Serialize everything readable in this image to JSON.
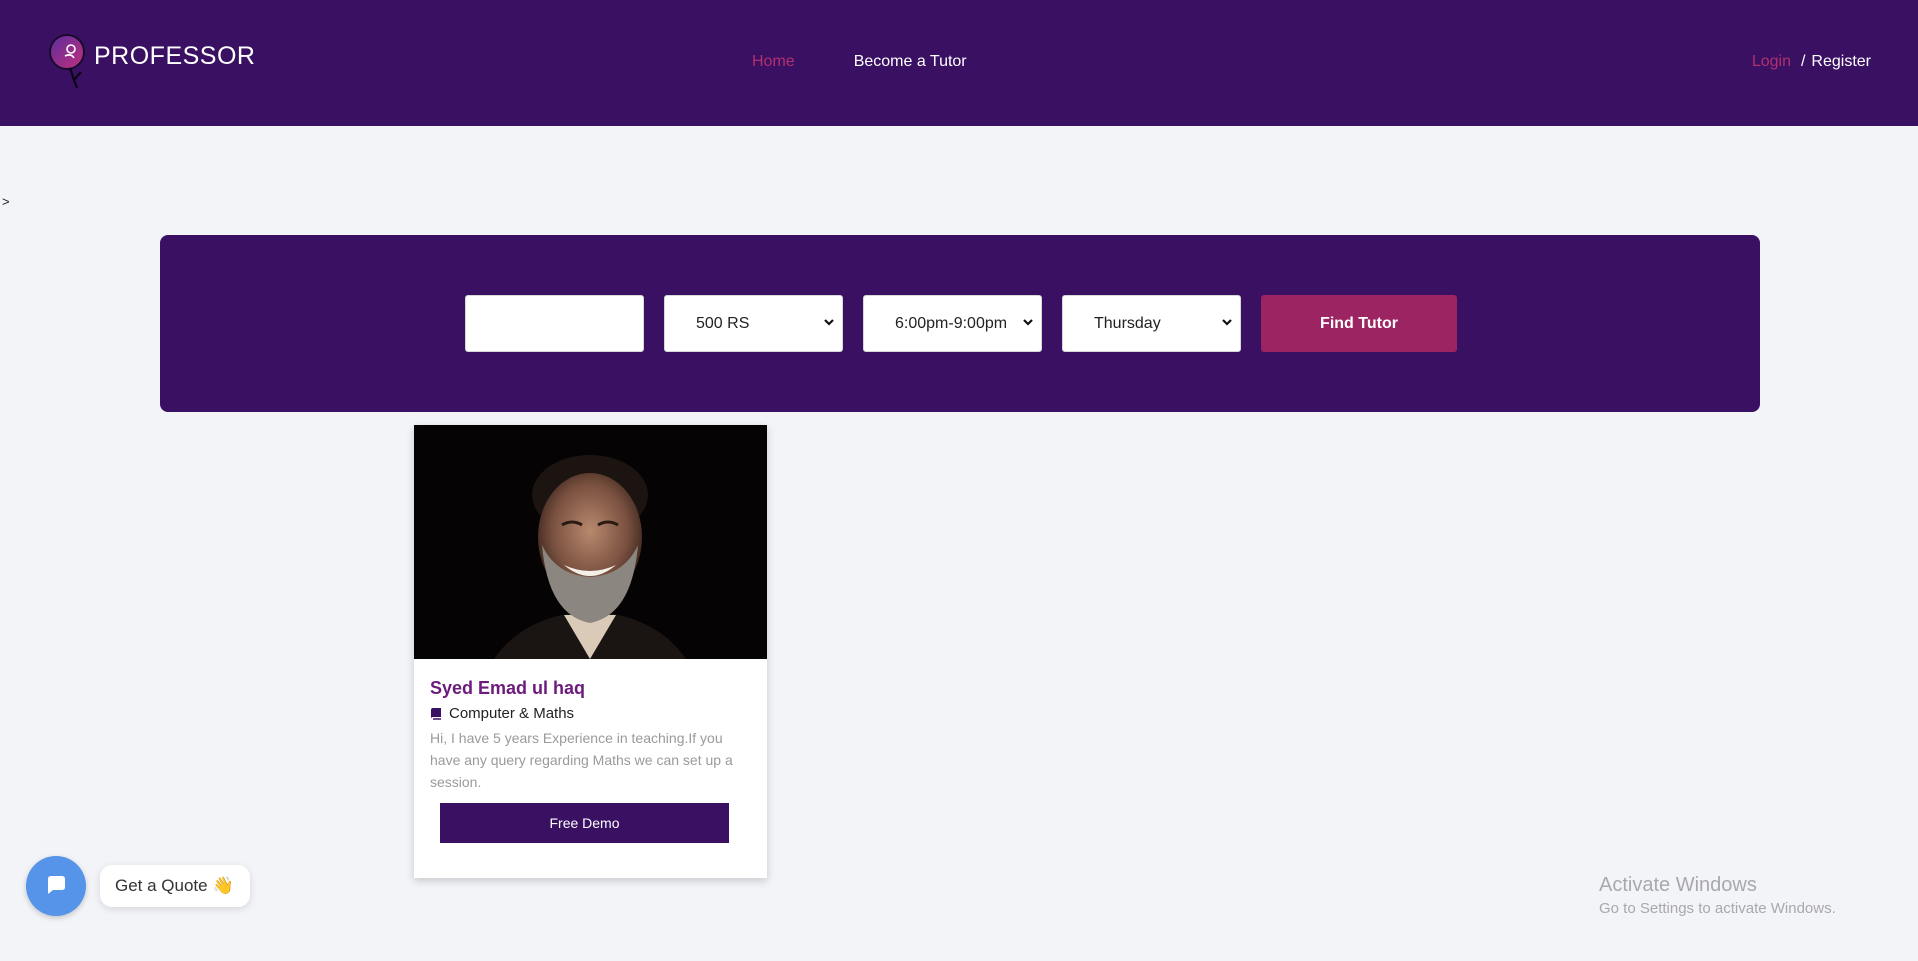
{
  "header": {
    "brand": "PROFESSOR",
    "nav": {
      "home": "Home",
      "become_tutor": "Become a Tutor"
    },
    "auth": {
      "login": "Login",
      "separator": "/",
      "register": "Register"
    }
  },
  "stray_text": ">",
  "search": {
    "text_input_value": "",
    "fee_selected": "500 RS",
    "time_selected": "6:00pm-9:00pm",
    "day_selected": "Thursday",
    "find_button": "Find Tutor"
  },
  "tutor_card": {
    "name": "Syed Emad ul haq",
    "subject": "Computer & Maths",
    "description": "Hi, I have 5 years Experience in teaching.If you have any query regarding Maths we can set up a session.",
    "demo_button": "Free Demo"
  },
  "chat_widget": {
    "quote_label": "Get a Quote",
    "quote_emoji": "👋"
  },
  "os_watermark": {
    "title": "Activate Windows",
    "subtitle": "Go to Settings to activate Windows."
  },
  "colors": {
    "header_bg": "#3a1063",
    "accent_pink": "#b2306f",
    "find_button_bg": "#9c2463",
    "name_purple": "#6c1b7c",
    "chat_blue": "#5594e8"
  },
  "icons": {
    "logo": "professor-logo-icon",
    "subject": "book-icon",
    "chat": "chat-bubble-icon",
    "select": "chevron-down-icon"
  }
}
